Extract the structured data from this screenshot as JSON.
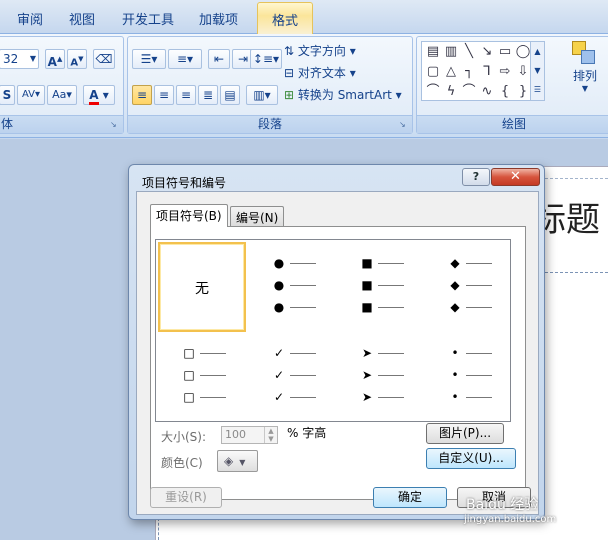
{
  "ribbon": {
    "tabs": [
      "审阅",
      "视图",
      "开发工具",
      "加载项",
      "格式"
    ],
    "font": {
      "size": "32",
      "group_label": "体"
    },
    "paragraph": {
      "group_label": "段落",
      "text_direction": "文字方向",
      "align_text": "对齐文本",
      "convert_smartart": "转换为 SmartArt"
    },
    "drawing": {
      "group_label": "绘图",
      "arrange": "排列"
    }
  },
  "slide": {
    "title_fragment": "标题"
  },
  "dialog": {
    "title": "项目符号和编号",
    "help": "?",
    "close": "✕",
    "tabs": [
      "项目符号(B)",
      "编号(N)"
    ],
    "gallery": {
      "none_label": "无",
      "bullets": [
        [
          "●",
          "■",
          "◆"
        ],
        [
          "□",
          "✓",
          "➤",
          "•"
        ]
      ]
    },
    "size_label": "大小(S):",
    "size_value": "100",
    "size_unit": "% 字高",
    "color_label": "颜色(C)",
    "picture_button": "图片(P)...",
    "customize_button": "自定义(U)...",
    "reset_button": "重设(R)",
    "ok_button": "确定",
    "cancel_button": "取消"
  },
  "watermark": {
    "text": "Baidu 经验",
    "url": "jingyan.baidu.com"
  }
}
